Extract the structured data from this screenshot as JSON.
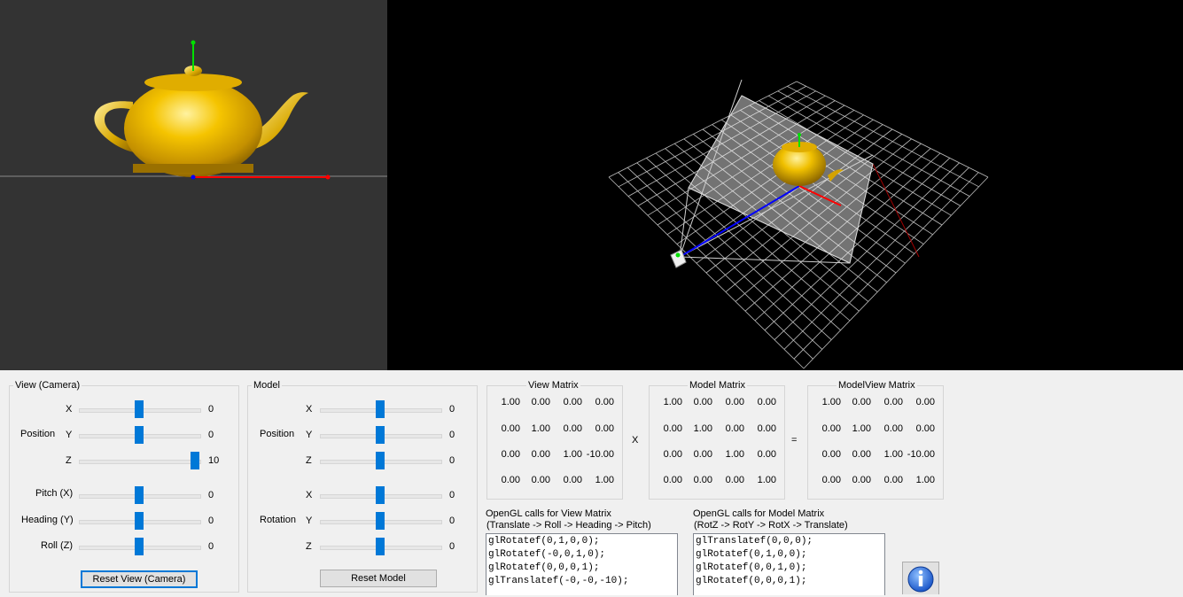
{
  "view_group": {
    "title": "View (Camera)",
    "position_label": "Position",
    "axes": [
      "X",
      "Y",
      "Z"
    ],
    "position_values": [
      "0",
      "0",
      "10"
    ],
    "position_levels": [
      0.5,
      0.5,
      1.0
    ],
    "pitch_label": "Pitch (X)",
    "heading_label": "Heading (Y)",
    "roll_label": "Roll (Z)",
    "rotation_values": [
      "0",
      "0",
      "0"
    ],
    "rotation_levels": [
      0.5,
      0.5,
      0.5
    ],
    "reset_label": "Reset View (Camera)"
  },
  "model_group": {
    "title": "Model",
    "position_label": "Position",
    "rotation_label": "Rotation",
    "axes": [
      "X",
      "Y",
      "Z"
    ],
    "position_values": [
      "0",
      "0",
      "0"
    ],
    "position_levels": [
      0.5,
      0.5,
      0.5
    ],
    "rotation_values": [
      "0",
      "0",
      "0"
    ],
    "rotation_levels": [
      0.5,
      0.5,
      0.5
    ],
    "reset_label": "Reset Model"
  },
  "matrices": {
    "view": {
      "title": "View Matrix",
      "rows": [
        [
          "1.00",
          "0.00",
          "0.00",
          "0.00"
        ],
        [
          "0.00",
          "1.00",
          "0.00",
          "0.00"
        ],
        [
          "0.00",
          "0.00",
          "1.00",
          "-10.00"
        ],
        [
          "0.00",
          "0.00",
          "0.00",
          "1.00"
        ]
      ]
    },
    "model": {
      "title": "Model Matrix",
      "rows": [
        [
          "1.00",
          "0.00",
          "0.00",
          "0.00"
        ],
        [
          "0.00",
          "1.00",
          "0.00",
          "0.00"
        ],
        [
          "0.00",
          "0.00",
          "1.00",
          "0.00"
        ],
        [
          "0.00",
          "0.00",
          "0.00",
          "1.00"
        ]
      ]
    },
    "modelview": {
      "title": "ModelView Matrix",
      "rows": [
        [
          "1.00",
          "0.00",
          "0.00",
          "0.00"
        ],
        [
          "0.00",
          "1.00",
          "0.00",
          "0.00"
        ],
        [
          "0.00",
          "0.00",
          "1.00",
          "-10.00"
        ],
        [
          "0.00",
          "0.00",
          "0.00",
          "1.00"
        ]
      ]
    },
    "times_symbol": "X",
    "equals_symbol": "="
  },
  "gl_view": {
    "title_line1": "OpenGL calls for View Matrix",
    "title_line2": "(Translate -> Roll -> Heading -> Pitch)",
    "lines": [
      "glRotatef(0,1,0,0);",
      "glRotatef(-0,0,1,0);",
      "glRotatef(0,0,0,1);",
      "glTranslatef(-0,-0,-10);"
    ]
  },
  "gl_model": {
    "title_line1": "OpenGL calls for Model Matrix",
    "title_line2": "(RotZ -> RotY -> RotX -> Translate)",
    "lines": [
      "glTranslatef(0,0,0);",
      "glRotatef(0,1,0,0);",
      "glRotatef(0,0,1,0);",
      "glRotatef(0,0,0,1);"
    ]
  },
  "icons": {
    "info": "info-icon"
  },
  "colors": {
    "accent": "#0078d7",
    "teapot": "#e6b800",
    "axis_x": "#ff0000",
    "axis_y": "#00ff00",
    "axis_z": "#0000ff"
  }
}
